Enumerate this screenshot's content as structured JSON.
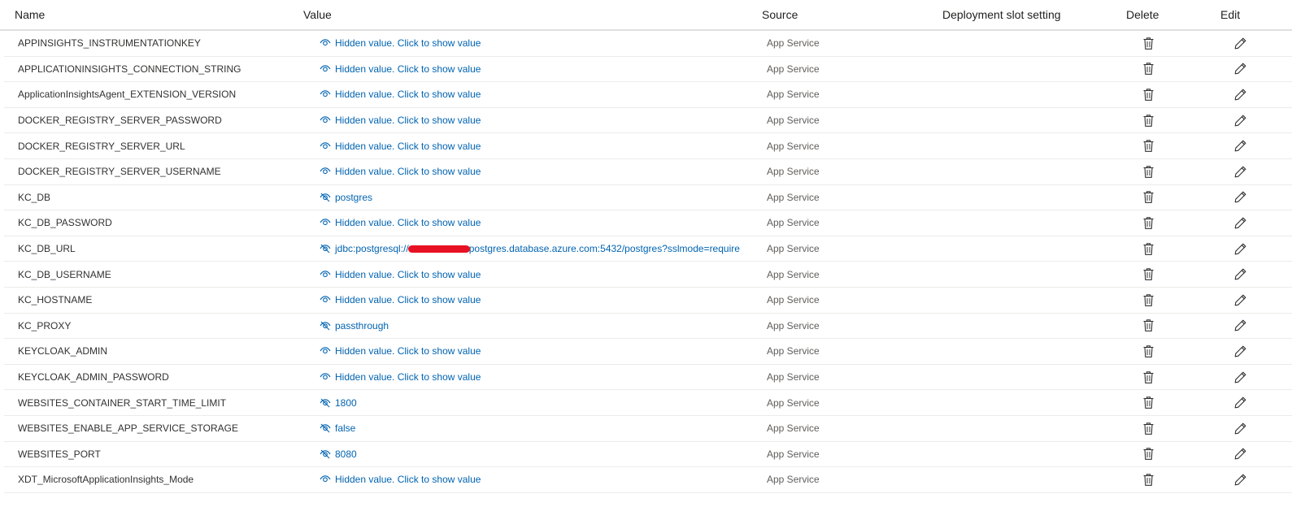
{
  "columns": {
    "name": "Name",
    "value": "Value",
    "source": "Source",
    "slot": "Deployment slot setting",
    "delete": "Delete",
    "edit": "Edit"
  },
  "rows": [
    {
      "name": "APPINSIGHTS_INSTRUMENTATIONKEY",
      "value": "Hidden value. Click to show value",
      "icon": "eye-icon",
      "source": "App Service"
    },
    {
      "name": "APPLICATIONINSIGHTS_CONNECTION_STRING",
      "value": "Hidden value. Click to show value",
      "icon": "eye-icon",
      "source": "App Service"
    },
    {
      "name": "ApplicationInsightsAgent_EXTENSION_VERSION",
      "value": "Hidden value. Click to show value",
      "icon": "eye-icon",
      "source": "App Service"
    },
    {
      "name": "DOCKER_REGISTRY_SERVER_PASSWORD",
      "value": "Hidden value. Click to show value",
      "icon": "eye-icon",
      "source": "App Service"
    },
    {
      "name": "DOCKER_REGISTRY_SERVER_URL",
      "value": "Hidden value. Click to show value",
      "icon": "eye-icon",
      "source": "App Service"
    },
    {
      "name": "DOCKER_REGISTRY_SERVER_USERNAME",
      "value": "Hidden value. Click to show value",
      "icon": "eye-icon",
      "source": "App Service"
    },
    {
      "name": "KC_DB",
      "value": "postgres",
      "icon": "eye-hide-icon",
      "source": "App Service"
    },
    {
      "name": "KC_DB_PASSWORD",
      "value": "Hidden value. Click to show value",
      "icon": "eye-icon",
      "source": "App Service"
    },
    {
      "name": "KC_DB_URL",
      "value_prefix": "jdbc:postgresql://",
      "value_suffix": "postgres.database.azure.com:5432/postgres?sslmode=require",
      "icon": "eye-hide-icon",
      "redacted": true,
      "source": "App Service"
    },
    {
      "name": "KC_DB_USERNAME",
      "value": "Hidden value. Click to show value",
      "icon": "eye-icon",
      "source": "App Service"
    },
    {
      "name": "KC_HOSTNAME",
      "value": "Hidden value. Click to show value",
      "icon": "eye-icon",
      "source": "App Service"
    },
    {
      "name": "KC_PROXY",
      "value": "passthrough",
      "icon": "eye-hide-icon",
      "source": "App Service"
    },
    {
      "name": "KEYCLOAK_ADMIN",
      "value": "Hidden value. Click to show value",
      "icon": "eye-icon",
      "source": "App Service"
    },
    {
      "name": "KEYCLOAK_ADMIN_PASSWORD",
      "value": "Hidden value. Click to show value",
      "icon": "eye-icon",
      "source": "App Service"
    },
    {
      "name": "WEBSITES_CONTAINER_START_TIME_LIMIT",
      "value": "1800",
      "icon": "eye-hide-icon",
      "source": "App Service"
    },
    {
      "name": "WEBSITES_ENABLE_APP_SERVICE_STORAGE",
      "value": "false",
      "icon": "eye-hide-icon",
      "source": "App Service"
    },
    {
      "name": "WEBSITES_PORT",
      "value": "8080",
      "icon": "eye-hide-icon",
      "source": "App Service"
    },
    {
      "name": "XDT_MicrosoftApplicationInsights_Mode",
      "value": "Hidden value. Click to show value",
      "icon": "eye-icon",
      "source": "App Service"
    }
  ],
  "colors": {
    "link": "#0063b1",
    "text": "#323130",
    "muted": "#605e5c",
    "redaction": "#e81123"
  }
}
